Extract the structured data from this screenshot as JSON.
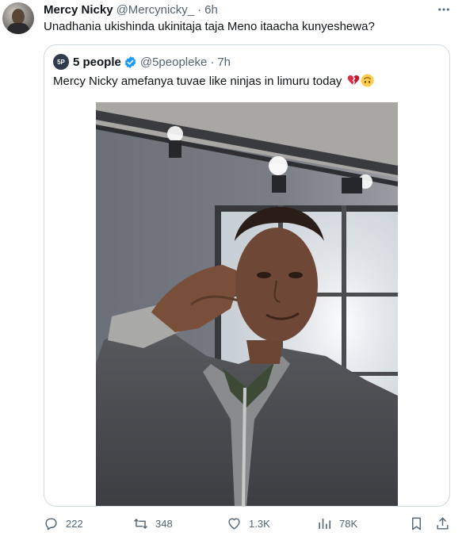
{
  "tweet": {
    "author_name": "Mercy Nicky",
    "author_handle": "@Mercynicky_",
    "separator": "·",
    "time": "6h",
    "text": "Unadhania ukishinda ukinitaja taja Meno itaacha kunyeshewa?"
  },
  "quoted": {
    "avatar_text": "5P",
    "author_name": "5 people",
    "author_handle": "@5peopleke",
    "separator": "·",
    "time": "7h",
    "text": "Mercy Nicky amefanya tuvae like ninjas in limuru today",
    "emojis": [
      "broken-heart",
      "upside-down-face"
    ]
  },
  "actions": {
    "replies": "222",
    "reposts": "348",
    "likes": "1.3K",
    "views": "78K"
  },
  "colors": {
    "text": "#0f1419",
    "muted": "#536471",
    "border": "#cfd9de",
    "verified": "#1d9bf0"
  }
}
